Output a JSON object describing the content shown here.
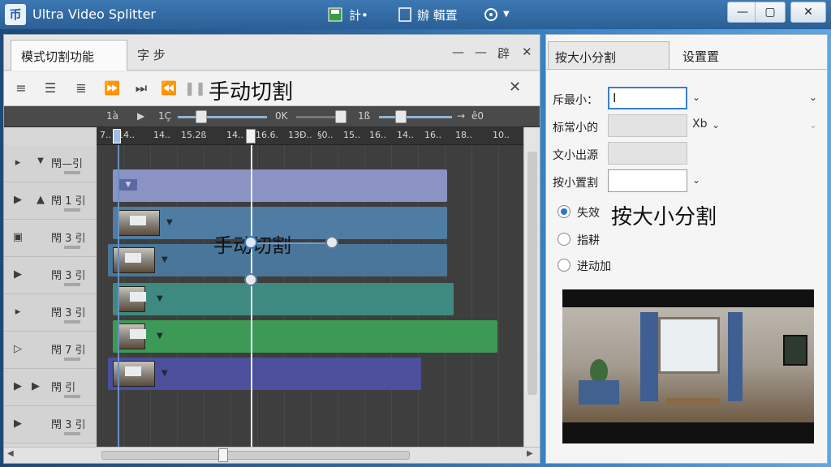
{
  "window": {
    "app_name": "Ultra Video Splitter",
    "logo_text": "币",
    "menu_item_1": "計•",
    "menu_item_2": "辦 輯置",
    "minimize": "—",
    "maximize": "▢",
    "close": "✕"
  },
  "left_panel": {
    "tab_active": "模式切割功能",
    "tab_2": "字 步",
    "tab_controls": [
      "—",
      "—",
      "辟",
      "✕"
    ],
    "toolbar_title": "手动切割",
    "toolbar_close": "✕",
    "timeline_controls": [
      "1à",
      "1Ç",
      "0K",
      "1ß",
      "ê0"
    ],
    "ruler_ticks": [
      "7..",
      "14..",
      "14..",
      "15.2ß",
      "14..",
      "16.6.",
      "13Ð..",
      "§0..",
      "15..",
      "16..",
      "14..",
      "16..",
      "18..",
      "10.."
    ],
    "tracks": [
      {
        "icon": "▸",
        "label": "閇—引"
      },
      {
        "icon": "▲",
        "label": "閇 1 引"
      },
      {
        "icon": "▣",
        "label": "閇 3 引"
      },
      {
        "icon": "▶",
        "label": "閇 3 引"
      },
      {
        "icon": "▸",
        "label": "閇 3 引"
      },
      {
        "icon": "▷",
        "label": "閇 7 引"
      },
      {
        "icon": "▶",
        "label": "閇 引"
      },
      {
        "icon": "▶",
        "label": "閇 3 引"
      }
    ],
    "clip_overlay_label": "手动切割"
  },
  "right_panel": {
    "tab_active": "按大小分割",
    "tab_inactive": "设置置",
    "fields": [
      {
        "label": "斥最小：",
        "value": "Ⅰ"
      },
      {
        "label": "标常小的",
        "value": "",
        "unit": "Xb"
      },
      {
        "label": "文小出源",
        "value": ""
      },
      {
        "label": "按小置割",
        "value": ""
      }
    ],
    "radio_options": [
      {
        "label": "失效",
        "checked": true
      },
      {
        "label": "指耕",
        "checked": false
      },
      {
        "label": "进动加",
        "checked": false
      }
    ],
    "big_label": "按大小分割"
  }
}
